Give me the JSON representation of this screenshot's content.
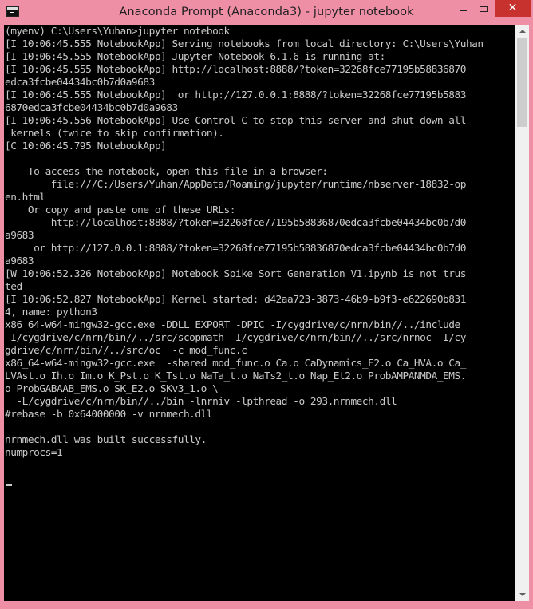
{
  "window": {
    "title": "Anaconda Prompt (Anaconda3) - jupyter  notebook",
    "close_glyph": "✕",
    "accent_color": "#ef8fa6",
    "close_color": "#c7312e",
    "icon": "console-icon"
  },
  "console": {
    "text": "(myenv) C:\\Users\\Yuhan>jupyter notebook\n[I 10:06:45.555 NotebookApp] Serving notebooks from local directory: C:\\Users\\Yuhan\n[I 10:06:45.555 NotebookApp] Jupyter Notebook 6.1.6 is running at:\n[I 10:06:45.555 NotebookApp] http://localhost:8888/?token=32268fce77195b58836870\nedca3fcbe04434bc0b7d0a9683\n[I 10:06:45.555 NotebookApp]  or http://127.0.0.1:8888/?token=32268fce77195b5883\n6870edca3fcbe04434bc0b7d0a9683\n[I 10:06:45.556 NotebookApp] Use Control-C to stop this server and shut down all\n kernels (twice to skip confirmation).\n[C 10:06:45.795 NotebookApp]\n\n    To access the notebook, open this file in a browser:\n        file:///C:/Users/Yuhan/AppData/Roaming/jupyter/runtime/nbserver-18832-op\nen.html\n    Or copy and paste one of these URLs:\n        http://localhost:8888/?token=32268fce77195b58836870edca3fcbe04434bc0b7d0\na9683\n     or http://127.0.0.1:8888/?token=32268fce77195b58836870edca3fcbe04434bc0b7d0\na9683\n[W 10:06:52.326 NotebookApp] Notebook Spike_Sort_Generation_V1.ipynb is not trus\nted\n[I 10:06:52.827 NotebookApp] Kernel started: d42aa723-3873-46b9-b9f3-e622690b831\n4, name: python3\nx86_64-w64-mingw32-gcc.exe -DDLL_EXPORT -DPIC -I/cygdrive/c/nrn/bin//../include\n-I/cygdrive/c/nrn/bin//../src/scopmath -I/cygdrive/c/nrn/bin//../src/nrnoc -I/cy\ngdrive/c/nrn/bin//../src/oc  -c mod_func.c\nx86_64-w64-mingw32-gcc.exe  -shared mod_func.o Ca.o CaDynamics_E2.o Ca_HVA.o Ca_\nLVAst.o Ih.o Im.o K_Pst.o K_Tst.o NaTa_t.o NaTs2_t.o Nap_Et2.o ProbAMPANMDA_EMS.\no ProbGABAAB_EMS.o SK_E2.o SKv3_1.o \\\n  -L/cygdrive/c/nrn/bin//../bin -lnrniv -lpthread -o 293.nrnmech.dll\n#rebase -b 0x64000000 -v nrnmech.dll\n\nnrnmech.dll was built successfully.\nnumprocs=1"
  }
}
